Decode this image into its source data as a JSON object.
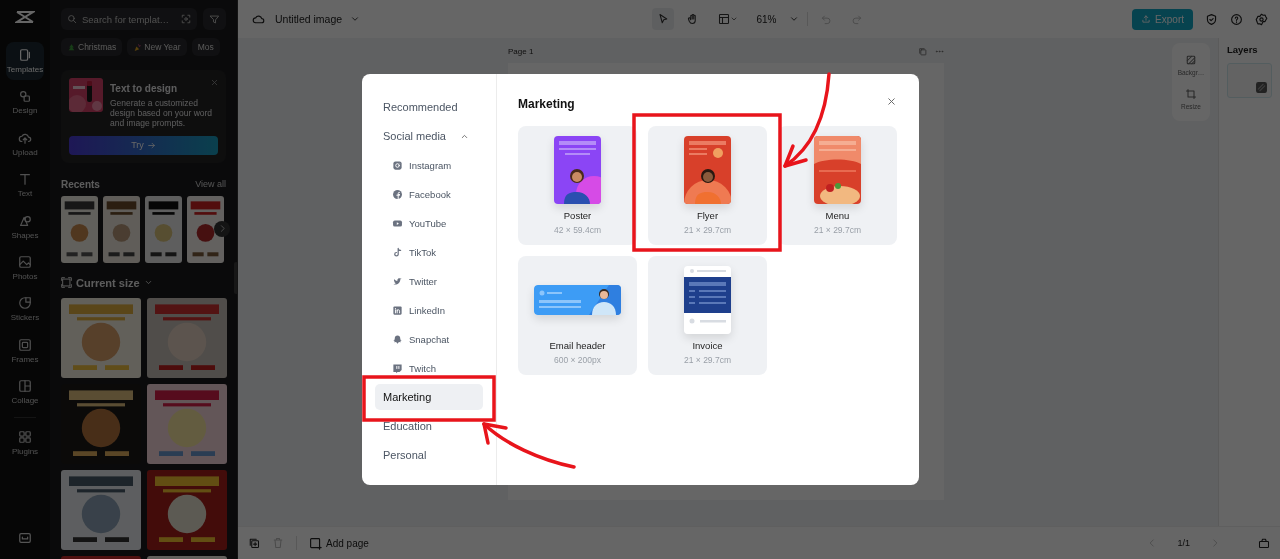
{
  "rail": {
    "items": [
      {
        "label": "Templates",
        "selected": true
      },
      {
        "label": "Design",
        "selected": false
      },
      {
        "label": "Upload",
        "selected": false
      },
      {
        "label": "Text",
        "selected": false
      },
      {
        "label": "Shapes",
        "selected": false
      },
      {
        "label": "Photos",
        "selected": false
      },
      {
        "label": "Stickers",
        "selected": false
      },
      {
        "label": "Frames",
        "selected": false
      },
      {
        "label": "Collage",
        "selected": false
      },
      {
        "label": "Plugins",
        "selected": false
      }
    ]
  },
  "sidebar": {
    "search": {
      "placeholder": "Search for templat…"
    },
    "chips": [
      "Christmas",
      "New Year",
      "Mos"
    ],
    "promo": {
      "title": "Text to design",
      "body": "Generate a customized design based on your word and image prompts.",
      "button": "Try"
    },
    "recents": {
      "title": "Recents",
      "link": "View all",
      "items": [
        {
          "kind": "picture"
        },
        {
          "kind": "picture"
        },
        {
          "kind": "picture"
        },
        {
          "kind": "picture"
        }
      ]
    },
    "size_filter": "Current size",
    "templates": [
      {
        "kind": "picture"
      },
      {
        "kind": "picture"
      },
      {
        "kind": "picture"
      },
      {
        "kind": "picture"
      },
      {
        "kind": "picture"
      },
      {
        "kind": "picture"
      },
      {
        "kind": "picture"
      },
      {
        "kind": "picture"
      }
    ]
  },
  "toolbar": {
    "title": "Untitled image",
    "zoom": "61%",
    "export": "Export"
  },
  "canvas": {
    "page_label": "Page 1"
  },
  "side_tools": [
    {
      "label": "Backgr…"
    },
    {
      "label": "Resize"
    }
  ],
  "layers": {
    "title": "Layers"
  },
  "bottom_bar": {
    "add_page": "Add page",
    "pager": "1/1"
  },
  "modal": {
    "nav": [
      {
        "label": "Recommended",
        "selected": false
      },
      {
        "label": "Social media",
        "selected": false,
        "expanded": true,
        "children": [
          {
            "label": "Instagram",
            "selected": false
          },
          {
            "label": "Facebook",
            "selected": false
          },
          {
            "label": "YouTube",
            "selected": false
          },
          {
            "label": "TikTok",
            "selected": false
          },
          {
            "label": "Twitter",
            "selected": false
          },
          {
            "label": "LinkedIn",
            "selected": false
          },
          {
            "label": "Snapchat",
            "selected": false
          },
          {
            "label": "Twitch",
            "selected": false
          }
        ]
      },
      {
        "label": "Marketing",
        "selected": true
      },
      {
        "label": "Education",
        "selected": false
      },
      {
        "label": "Personal",
        "selected": false
      }
    ],
    "title": "Marketing",
    "cards": [
      {
        "name": "Poster",
        "size": "42 × 59.4cm"
      },
      {
        "name": "Flyer",
        "size": "21 × 29.7cm"
      },
      {
        "name": "Menu",
        "size": "21 × 29.7cm"
      },
      {
        "name": "Email header",
        "size": "600 × 200px"
      },
      {
        "name": "Invoice",
        "size": "21 × 29.7cm"
      }
    ]
  }
}
